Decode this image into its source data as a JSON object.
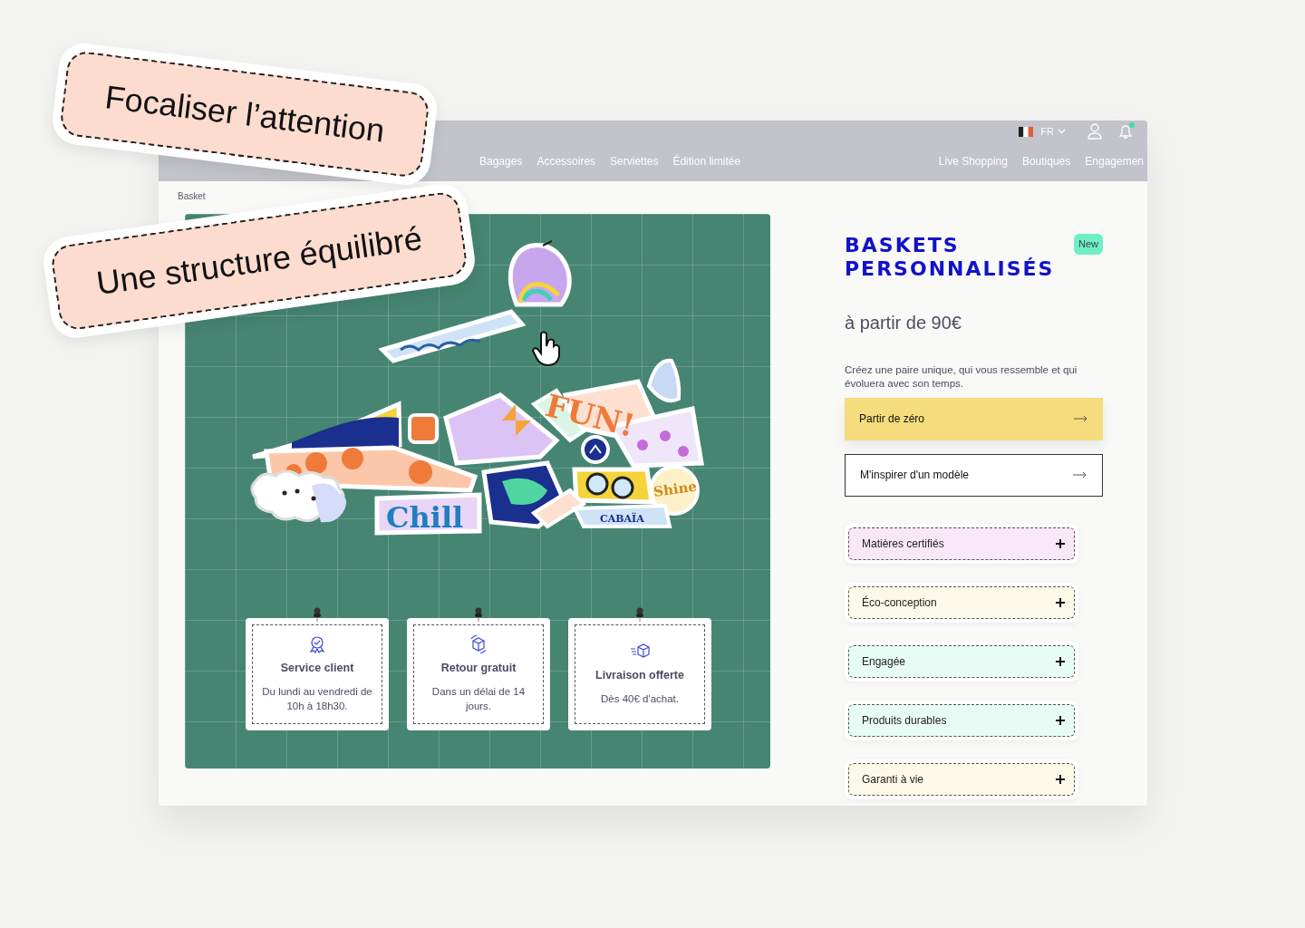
{
  "stickers": [
    {
      "text": "Focaliser l’attention"
    },
    {
      "text": "Une structure équilibré"
    }
  ],
  "nav": {
    "language": "FR",
    "links": [
      "Bagages",
      "Accessoires",
      "Serviettes",
      "Édition limitée"
    ],
    "right_links": [
      "Live Shopping",
      "Boutiques",
      "Engagemen"
    ]
  },
  "breadcrumb": [
    "Basket"
  ],
  "collage": {
    "labels": [
      "FUN!",
      "Chill",
      "Shine",
      "CABAÏA"
    ]
  },
  "info_cards": [
    {
      "kind": "award",
      "title": "Service client",
      "text": "Du lundi au vendredi de 10h à 18h30."
    },
    {
      "kind": "return",
      "title": "Retour gratuit",
      "text": "Dans un délai de 14 jours."
    },
    {
      "kind": "delivery",
      "title": "Livraison offerte",
      "text": "Dès 40€ d'achat."
    }
  ],
  "product": {
    "title": "BASKETS PERSONNALISÉS",
    "badge": "New",
    "price": "à partir de 90€",
    "description": "Créez une paire unique, qui vous ressemble et qui évoluera avec son temps.",
    "buttons": [
      {
        "label": "Partir de zéro",
        "kind": "primary"
      },
      {
        "label": "M'inspirer d'un modèle",
        "kind": "outline"
      }
    ],
    "features": [
      {
        "label": "Matières certifiés",
        "color": "#f8e8f8"
      },
      {
        "label": "Éco-conception",
        "color": "#fdf9e8"
      },
      {
        "label": "Engagée",
        "color": "#e8fcf6"
      },
      {
        "label": "Produits durables",
        "color": "#e8fcf6"
      },
      {
        "label": "Garanti à vie",
        "color": "#fdf9e8"
      }
    ]
  }
}
